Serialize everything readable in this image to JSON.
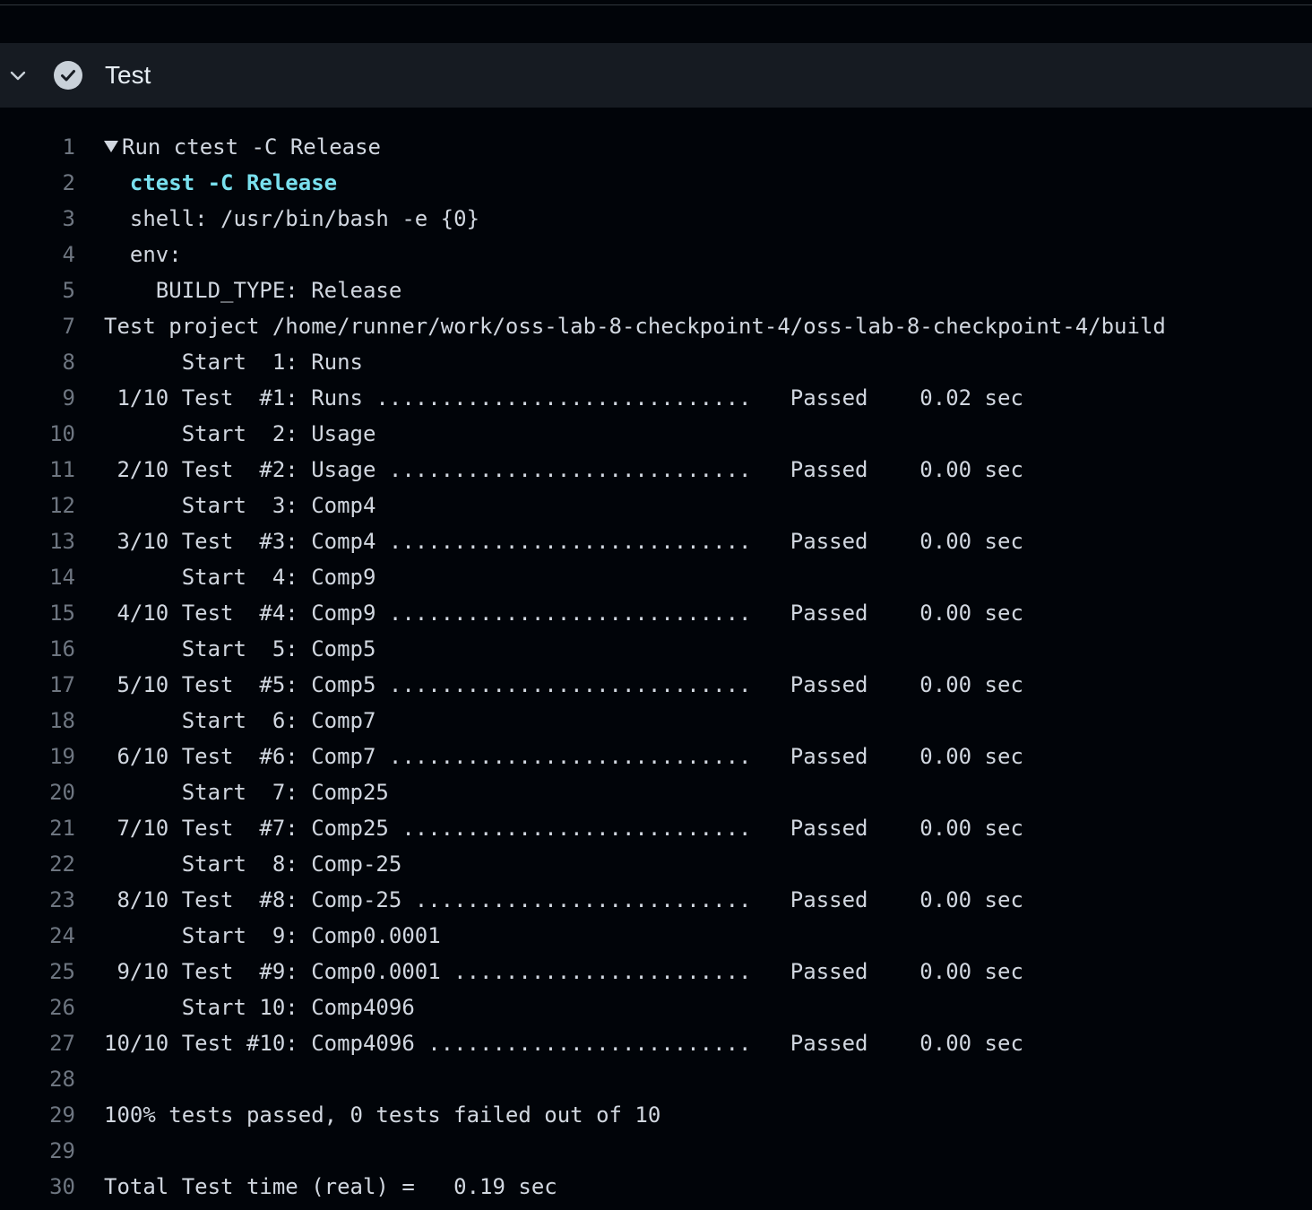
{
  "step": {
    "title": "Test",
    "status_icon": "check-circle-icon",
    "toggle_icon": "chevron-down-icon"
  },
  "colors": {
    "background": "#010409",
    "header_background": "#161b22",
    "command_color": "#79e0ee",
    "line_number_color": "#6e7681"
  },
  "log": {
    "lines": [
      {
        "num": "1",
        "text": "Run ctest -C Release",
        "type": "group"
      },
      {
        "num": "2",
        "text": "  ctest -C Release",
        "type": "cmd"
      },
      {
        "num": "3",
        "text": "  shell: /usr/bin/bash -e {0}",
        "type": "plain"
      },
      {
        "num": "4",
        "text": "  env:",
        "type": "plain"
      },
      {
        "num": "5",
        "text": "    BUILD_TYPE: Release",
        "type": "plain"
      },
      {
        "num": "7",
        "text": "Test project /home/runner/work/oss-lab-8-checkpoint-4/oss-lab-8-checkpoint-4/build",
        "type": "plain"
      },
      {
        "num": "8",
        "text": "      Start  1: Runs",
        "type": "plain"
      },
      {
        "num": "9",
        "text": " 1/10 Test  #1: Runs .............................   Passed    0.02 sec",
        "type": "plain"
      },
      {
        "num": "10",
        "text": "      Start  2: Usage",
        "type": "plain"
      },
      {
        "num": "11",
        "text": " 2/10 Test  #2: Usage ............................   Passed    0.00 sec",
        "type": "plain"
      },
      {
        "num": "12",
        "text": "      Start  3: Comp4",
        "type": "plain"
      },
      {
        "num": "13",
        "text": " 3/10 Test  #3: Comp4 ............................   Passed    0.00 sec",
        "type": "plain"
      },
      {
        "num": "14",
        "text": "      Start  4: Comp9",
        "type": "plain"
      },
      {
        "num": "15",
        "text": " 4/10 Test  #4: Comp9 ............................   Passed    0.00 sec",
        "type": "plain"
      },
      {
        "num": "16",
        "text": "      Start  5: Comp5",
        "type": "plain"
      },
      {
        "num": "17",
        "text": " 5/10 Test  #5: Comp5 ............................   Passed    0.00 sec",
        "type": "plain"
      },
      {
        "num": "18",
        "text": "      Start  6: Comp7",
        "type": "plain"
      },
      {
        "num": "19",
        "text": " 6/10 Test  #6: Comp7 ............................   Passed    0.00 sec",
        "type": "plain"
      },
      {
        "num": "20",
        "text": "      Start  7: Comp25",
        "type": "plain"
      },
      {
        "num": "21",
        "text": " 7/10 Test  #7: Comp25 ...........................   Passed    0.00 sec",
        "type": "plain"
      },
      {
        "num": "22",
        "text": "      Start  8: Comp-25",
        "type": "plain"
      },
      {
        "num": "23",
        "text": " 8/10 Test  #8: Comp-25 ..........................   Passed    0.00 sec",
        "type": "plain"
      },
      {
        "num": "24",
        "text": "      Start  9: Comp0.0001",
        "type": "plain"
      },
      {
        "num": "25",
        "text": " 9/10 Test  #9: Comp0.0001 .......................   Passed    0.00 sec",
        "type": "plain"
      },
      {
        "num": "26",
        "text": "      Start 10: Comp4096",
        "type": "plain"
      },
      {
        "num": "27",
        "text": "10/10 Test #10: Comp4096 .........................   Passed    0.00 sec",
        "type": "plain"
      },
      {
        "num": "28",
        "text": "",
        "type": "plain"
      },
      {
        "num": "29",
        "text": "100% tests passed, 0 tests failed out of 10",
        "type": "plain"
      },
      {
        "num": "29",
        "text": "",
        "type": "plain"
      },
      {
        "num": "30",
        "text": "Total Test time (real) =   0.19 sec",
        "type": "plain"
      }
    ]
  }
}
